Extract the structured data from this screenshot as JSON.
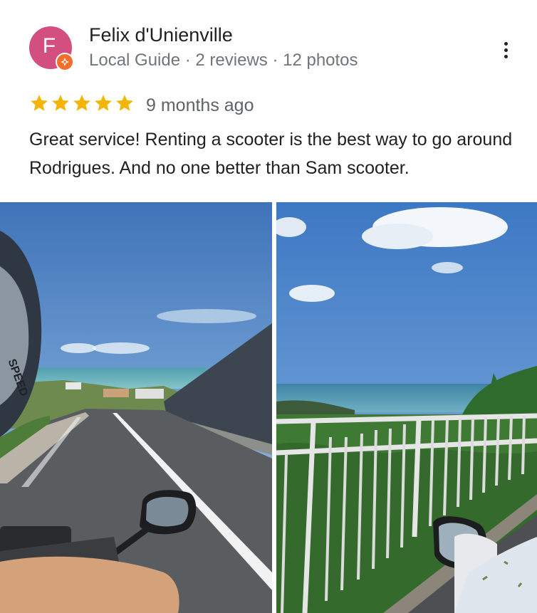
{
  "reviewer": {
    "initial": "F",
    "name": "Felix d'Unienville",
    "meta": "Local Guide · 2 reviews · 12 photos",
    "avatar_color": "#d34f7f",
    "badge_color": "#f36d2c"
  },
  "review": {
    "rating": 5,
    "max_rating": 5,
    "star_color": "#f4b400",
    "date": "9 months ago",
    "text": "Great service! Renting a scooter is the best way to go around Rodrigues. And no one better than Sam scooter."
  },
  "photos": [
    {
      "icon": "photo-road-helmet-mirror"
    },
    {
      "icon": "photo-railing-ocean-view"
    }
  ],
  "icons": {
    "more": "more-vert-icon",
    "star": "star-icon",
    "badge": "local-guide-badge-icon"
  }
}
